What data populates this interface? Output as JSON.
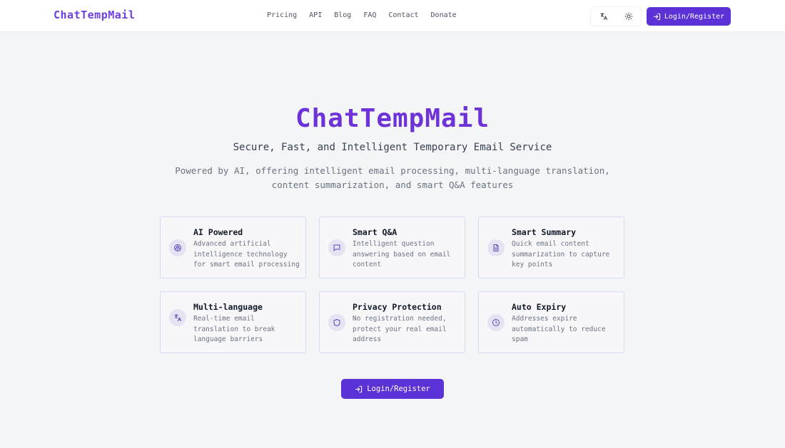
{
  "header": {
    "brand": "ChatTempMail",
    "nav": [
      "Pricing",
      "API",
      "Blog",
      "FAQ",
      "Contact",
      "Donate"
    ],
    "login_label": "Login/Register"
  },
  "hero": {
    "title": "ChatTempMail",
    "subtitle": "Secure, Fast, and Intelligent Temporary Email Service",
    "description": "Powered by AI, offering intelligent email processing, multi-language translation, content summarization, and smart Q&A features"
  },
  "features": [
    {
      "title": "AI Powered",
      "desc": "Advanced artificial intelligence technology for smart email processing",
      "icon": "brain-icon"
    },
    {
      "title": "Smart Q&A",
      "desc": "Intelligent question answering based on email content",
      "icon": "chat-bubble-icon"
    },
    {
      "title": "Smart Summary",
      "desc": "Quick email content summarization to capture key points",
      "icon": "document-icon"
    },
    {
      "title": "Multi-language",
      "desc": "Real-time email translation to break language barriers",
      "icon": "translate-icon"
    },
    {
      "title": "Privacy Protection",
      "desc": "No registration needed, protect your real email address",
      "icon": "shield-icon"
    },
    {
      "title": "Auto Expiry",
      "desc": "Addresses expire automatically to reduce spam",
      "icon": "clock-icon"
    }
  ],
  "cta": {
    "label": "Login/Register"
  },
  "colors": {
    "accent": "#5b32d6",
    "brand_text": "#6d32d8",
    "card_border": "#d6d9f2"
  }
}
